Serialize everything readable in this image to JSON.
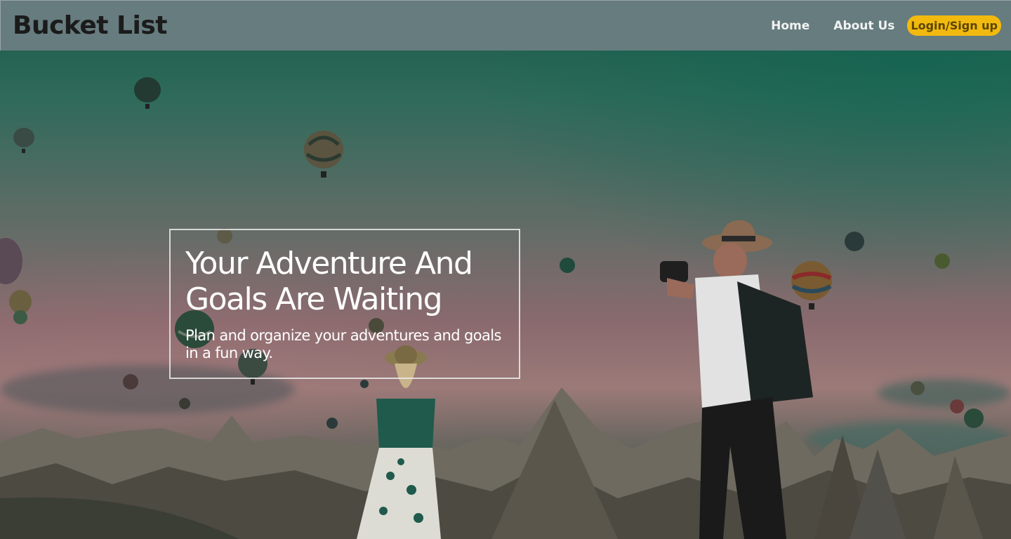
{
  "nav": {
    "brand": "Bucket List",
    "links": [
      "Home",
      "About Us"
    ],
    "login_label": "Login/Sign up"
  },
  "hero": {
    "title": "Your Adventure And Goals Are Waiting",
    "subtitle": "Plan and organize your adventures and goals in a fun way."
  },
  "colors": {
    "navbar": "#697d80",
    "login_button": "#f2b90f",
    "brand_text": "#1b1b1b"
  }
}
